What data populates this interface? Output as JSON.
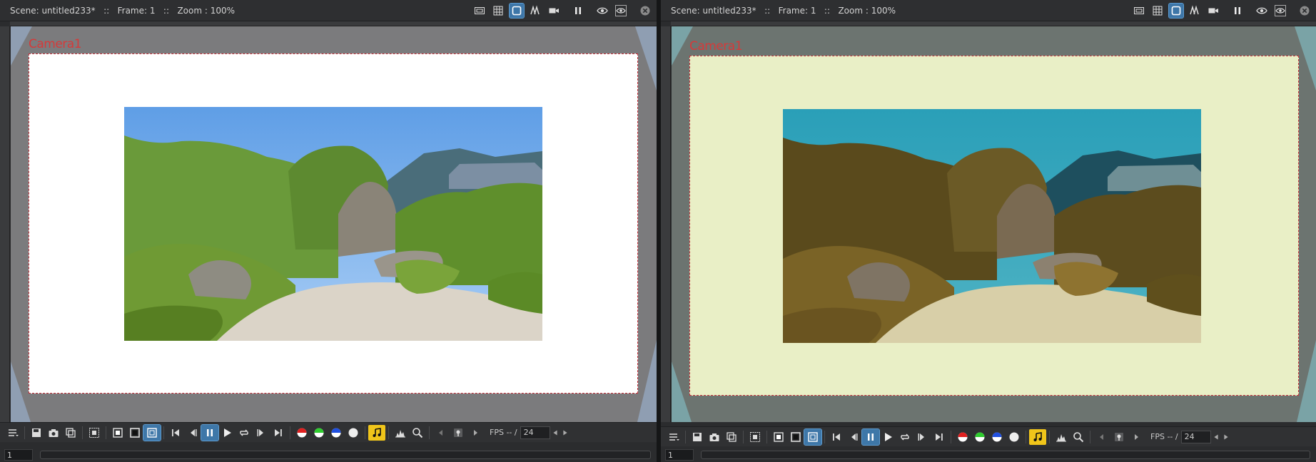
{
  "panes": [
    {
      "id": "left",
      "title": "Scene: untitled233*   ::   Frame: 1   ::   Zoom : 100%",
      "camera_label": "Camera1",
      "variant": "original",
      "fps_label": "FPS -- /",
      "fps_value": "24",
      "frame_value": "1"
    },
    {
      "id": "right",
      "title": "Scene: untitled233*   ::   Frame: 1   ::   Zoom : 100%",
      "camera_label": "Camera1",
      "variant": "tinted",
      "fps_label": "FPS -- /",
      "fps_value": "24",
      "frame_value": "1"
    }
  ],
  "header_icons": [
    "safe-area-icon",
    "field-guide-icon",
    "camera-view-icon",
    "3d-view-icon",
    "camera-icon",
    "freeze-icon",
    "preview-eye-icon",
    "sub-camera-preview-icon",
    "close-icon"
  ],
  "toolbar_icons": [
    "menu-icon",
    "save-icon",
    "snapshot-icon",
    "compare-icon",
    "define-region-icon",
    "white-bg-icon",
    "black-bg-icon",
    "checker-bg-icon",
    "first-frame-icon",
    "prev-frame-icon",
    "pause-icon",
    "play-icon",
    "loop-icon",
    "next-frame-icon",
    "last-frame-icon",
    "red-channel-icon",
    "green-channel-icon",
    "blue-channel-icon",
    "alpha-channel-icon",
    "sound-icon",
    "histogram-icon",
    "magnifier-icon",
    "prev-key-icon",
    "locator-icon",
    "next-key-icon"
  ],
  "colors": {
    "accent": "#3d76a8",
    "camera_red": "#d53a3a",
    "sound_yellow": "#f0c51a",
    "left_bg": "#7b7b7d",
    "left_frame": "#ffffff",
    "right_bg": "#6c7470",
    "right_frame": "#e9efc6"
  }
}
